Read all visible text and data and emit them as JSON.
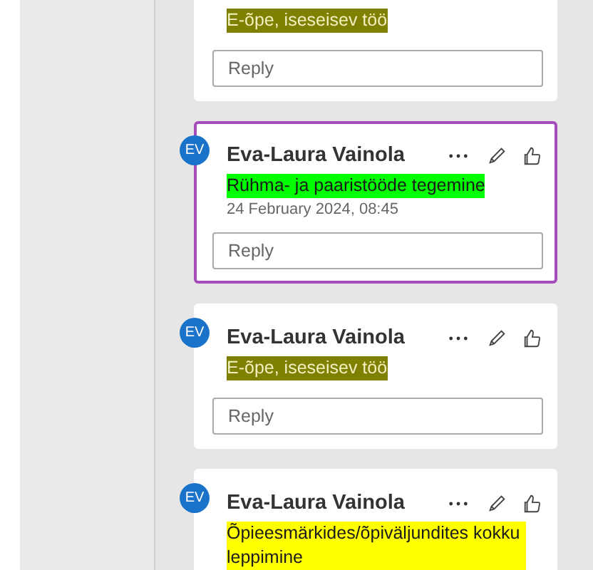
{
  "comments": [
    {
      "text": "E-õpe, iseseisev töö",
      "color": "#808000",
      "selected": false,
      "reply_placeholder": "Reply"
    },
    {
      "author": "Eva-Laura Vainola",
      "initials": "EV",
      "text": "Rühma- ja paaristööde tegemine",
      "color": "#00ff00",
      "date": "24 February 2024, 08:45",
      "selected": true,
      "reply_placeholder": "Reply"
    },
    {
      "author": "Eva-Laura Vainola",
      "initials": "EV",
      "text": "E-õpe, iseseisev töö",
      "color": "#808000",
      "selected": false,
      "reply_placeholder": "Reply"
    },
    {
      "author": "Eva-Laura Vainola",
      "initials": "EV",
      "text": "Õpieesmärkides/õpiväljundites kokku leppimine",
      "color": "#ffff00",
      "selected": false
    }
  ]
}
